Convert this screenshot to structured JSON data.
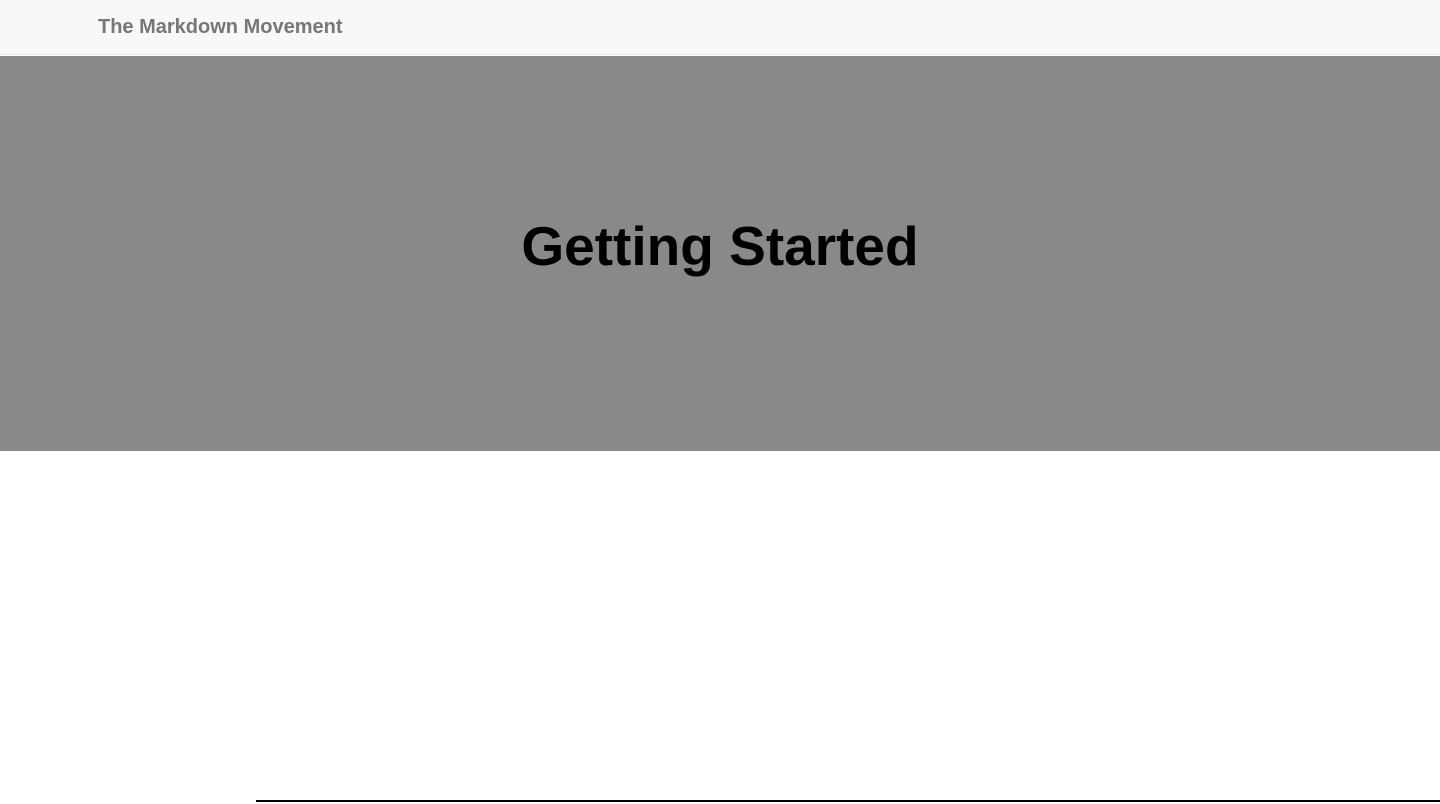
{
  "navbar": {
    "brand": "The Markdown Movement"
  },
  "hero": {
    "title": "Getting Started"
  },
  "colors": {
    "navbar_background": "#f8f8f8",
    "brand_text": "#777777",
    "hero_background": "#898989",
    "hero_title": "#000000",
    "page_background": "#ffffff"
  }
}
